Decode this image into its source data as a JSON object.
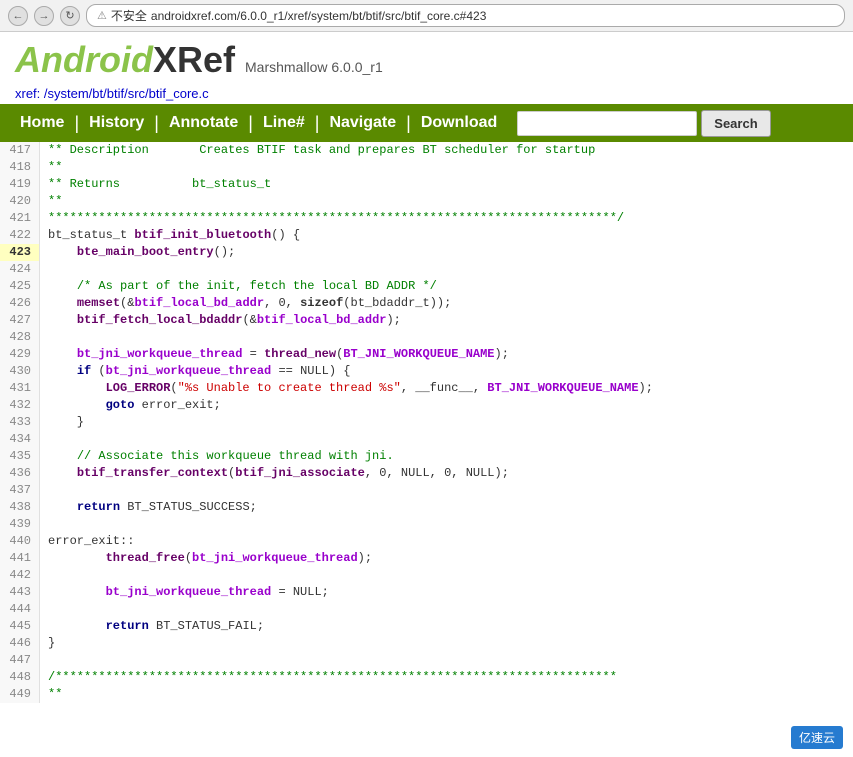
{
  "browser": {
    "url": "androidxref.com/6.0.0_r1/xref/system/bt/btif/src/btif_core.c#423",
    "url_display": "androidxref.com/6.0.0_r1/xref/system/bt/btif/src/btif_core.c#423",
    "security_label": "不安全"
  },
  "header": {
    "logo_android": "Android",
    "logo_xref": "XRef",
    "logo_version": "Marshmallow 6.0.0_r1"
  },
  "breadcrumb": {
    "text": "xref: /system/bt/btif/src/btif_core.c"
  },
  "nav": {
    "items": [
      "Home",
      "History",
      "Annotate",
      "Line#",
      "Navigate",
      "Download"
    ],
    "search_placeholder": "",
    "search_btn_label": "Search"
  },
  "watermark": "亿速云"
}
